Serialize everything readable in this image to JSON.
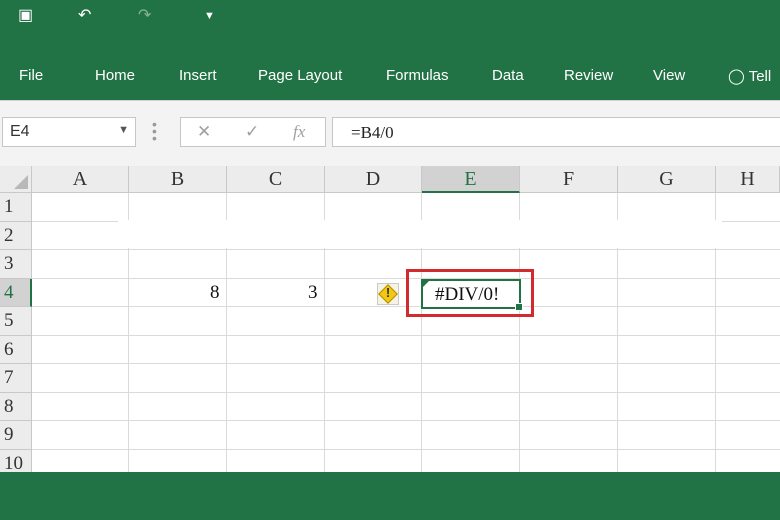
{
  "ribbon": {
    "tabs": [
      "File",
      "Home",
      "Insert",
      "Page Layout",
      "Formulas",
      "Data",
      "Review",
      "View",
      "Tell"
    ]
  },
  "formula_bar": {
    "name_box": "E4",
    "formula": "=B4/0"
  },
  "sheet": {
    "columns": [
      "A",
      "B",
      "C",
      "D",
      "E",
      "F",
      "G",
      "H"
    ],
    "rows": [
      "1",
      "2",
      "3",
      "4",
      "5",
      "6",
      "7",
      "8",
      "9",
      "10"
    ],
    "selected_column": "E",
    "selected_row": "4",
    "cells": {
      "B4": "8",
      "C4": "3",
      "E4": "#DIV/0!"
    }
  },
  "colors": {
    "brand": "#217346",
    "highlight": "#d12b2f"
  },
  "icons": [
    "save-icon",
    "undo-icon",
    "redo-icon",
    "customize-qat-icon",
    "lightbulb-icon",
    "cancel-icon",
    "enter-icon",
    "function-icon",
    "error-warning-icon"
  ]
}
